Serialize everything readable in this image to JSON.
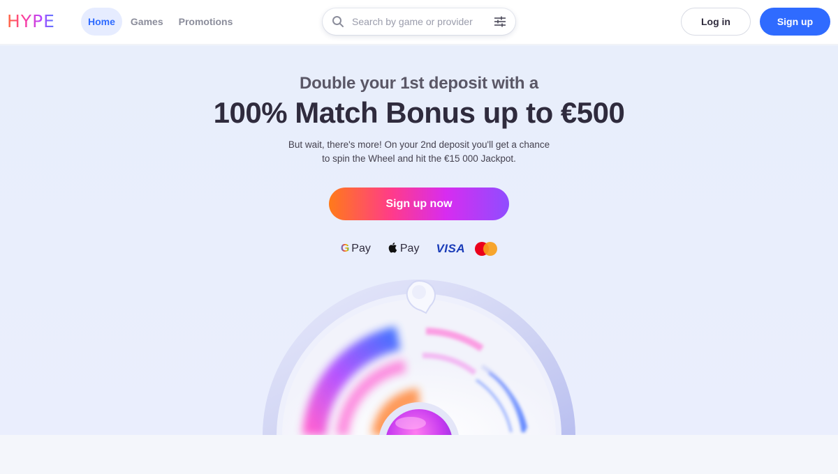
{
  "header": {
    "logo": "HYPE",
    "nav": [
      {
        "label": "Home",
        "active": true
      },
      {
        "label": "Games",
        "active": false
      },
      {
        "label": "Promotions",
        "active": false
      }
    ],
    "search": {
      "placeholder": "Search by game or provider",
      "value": ""
    },
    "login_label": "Log in",
    "signup_label": "Sign up"
  },
  "hero": {
    "subtitle": "Double your 1st deposit with a",
    "title": "100% Match Bonus up to €500",
    "description_line1": "But wait, there's more! On your 2nd deposit you'll get a chance",
    "description_line2": "to spin the Wheel and hit the €15 000 Jackpot.",
    "cta_label": "Sign up now"
  },
  "payments": {
    "gpay_g": "G",
    "gpay_text": "Pay",
    "applepay_text": "Pay",
    "visa_text": "VISA"
  },
  "icons": [
    "search-icon",
    "filter-icon",
    "apple-icon",
    "mastercard-icon",
    "prize-wheel"
  ],
  "colors": {
    "accent": "#2f6bff",
    "nav_active_bg": "#e6ecff",
    "text_dark": "#2f2b3d",
    "cta_gradient": [
      "#ff7a1a",
      "#ff3b8a",
      "#d72cf0",
      "#8f4dff"
    ]
  }
}
